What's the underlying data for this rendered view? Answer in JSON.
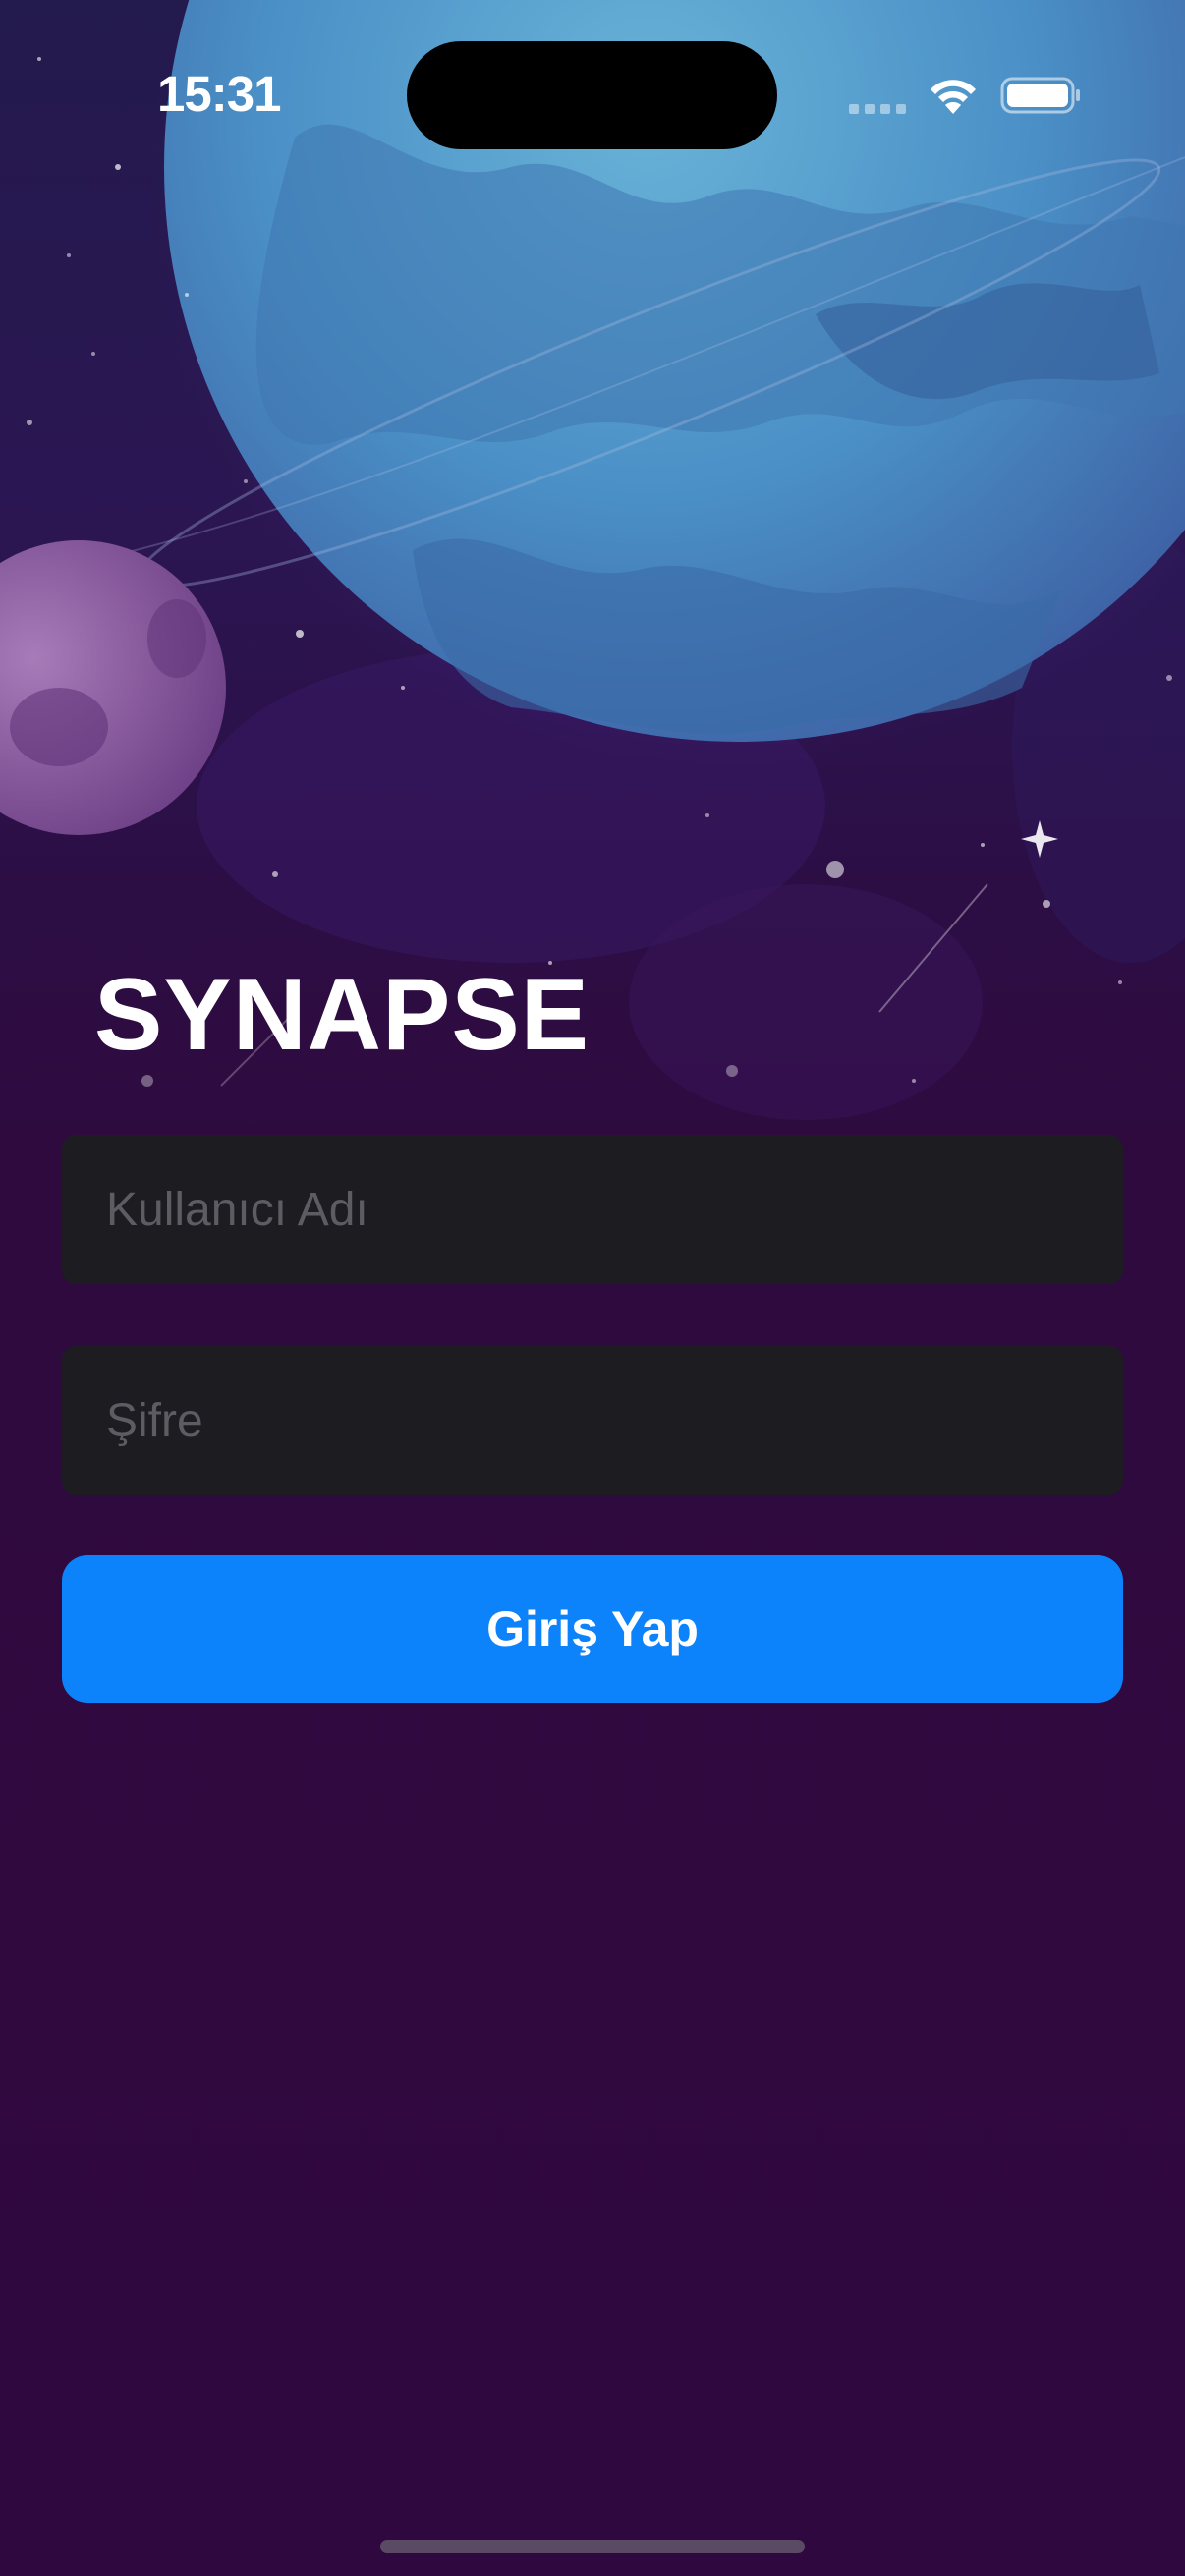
{
  "status_bar": {
    "time": "15:31",
    "icons": [
      "cellular-signal-icon",
      "wifi-icon",
      "battery-icon"
    ]
  },
  "background": {
    "icon": "space-planet-illustration",
    "colors": {
      "sky_top": "#2a1550",
      "sky_bottom": "#2f0a3e",
      "planet": "#4b8fc4",
      "moon": "#8a5d9c"
    }
  },
  "login": {
    "title": "SYNAPSE",
    "username_placeholder": "Kullanıcı Adı",
    "password_placeholder": "Şifre",
    "submit_label": "Giriş Yap"
  },
  "colors": {
    "background": "#2f0a3e",
    "field_background": "#1d1c21",
    "placeholder": "#5d5c62",
    "button": "#0c82fb",
    "text": "#ffffff"
  }
}
